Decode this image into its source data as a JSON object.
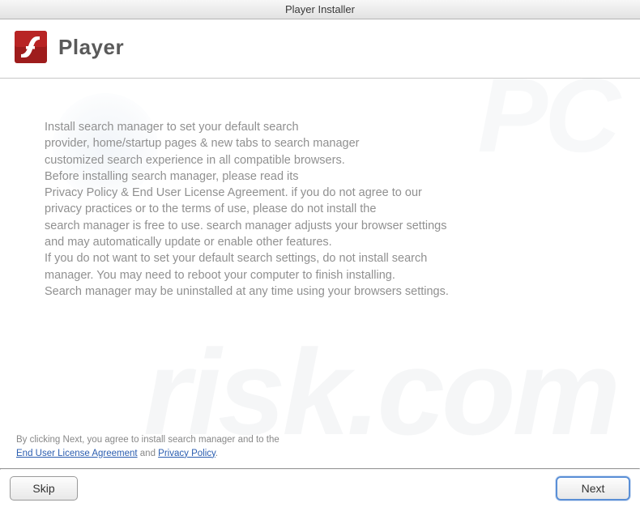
{
  "window": {
    "title": "Player Installer"
  },
  "header": {
    "title": "Player"
  },
  "body": {
    "text": "Install search manager to set your default search\nprovider, home/startup pages & new tabs to search manager\ncustomized search experience in all compatible browsers.\nBefore installing search manager, please read its\nPrivacy Policy & End User License Agreement. if you do not agree to our\nprivacy practices or to the terms of use, please do not install the\nsearch manager is free to use. search manager adjusts your browser settings\nand may automatically update or enable other features.\nIf you do not want to set your default search settings, do not install search\nmanager. You may need to reboot your computer to finish installing.\nSearch manager may be uninstalled at any time using your browsers settings."
  },
  "footer": {
    "prefix": "By clicking Next, you agree to install search manager and to the",
    "eula": "End User License Agreement",
    "and": " and ",
    "privacy": "Privacy Policy",
    "suffix": "."
  },
  "buttons": {
    "skip": "Skip",
    "next": "Next"
  },
  "watermark": {
    "top": "PC",
    "bottom": "risk.com"
  }
}
